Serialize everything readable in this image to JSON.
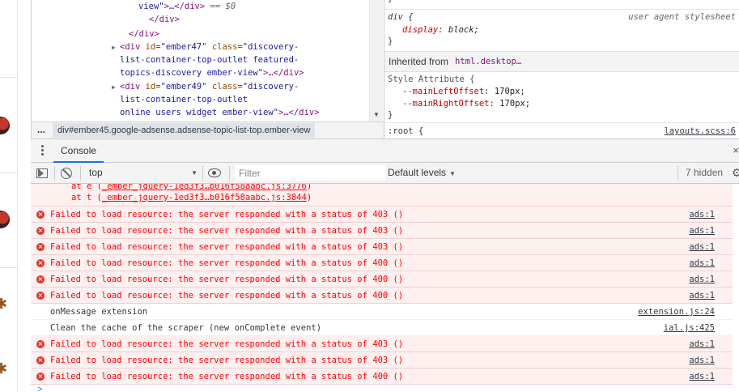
{
  "elements_panel": {
    "lines": [
      {
        "indent": 170,
        "tokens": [
          {
            "c": "val",
            "t": "view\""
          },
          {
            "c": "tag",
            "t": ">…</div>"
          },
          {
            "c": "dim",
            "t": " == $0"
          }
        ]
      },
      {
        "indent": 183,
        "tokens": [
          {
            "c": "tag",
            "t": "</div>"
          }
        ]
      },
      {
        "indent": 158,
        "tokens": [
          {
            "c": "tag",
            "t": "</div>"
          }
        ]
      },
      {
        "indent": 147,
        "arrow": true,
        "tokens": [
          {
            "c": "tag",
            "t": "<div "
          },
          {
            "c": "attr",
            "t": "id"
          },
          {
            "c": "tag",
            "t": "="
          },
          {
            "c": "val",
            "t": "\"ember47\""
          },
          {
            "c": "attr",
            "t": " class"
          },
          {
            "c": "tag",
            "t": "="
          },
          {
            "c": "val",
            "t": "\"discovery-"
          }
        ]
      },
      {
        "indent": 147,
        "tokens": [
          {
            "c": "val",
            "t": "list-container-top-outlet featured-"
          }
        ]
      },
      {
        "indent": 147,
        "tokens": [
          {
            "c": "val",
            "t": "topics-discovery ember-view\""
          },
          {
            "c": "tag",
            "t": ">…</div>"
          }
        ]
      },
      {
        "indent": 147,
        "arrow": true,
        "tokens": [
          {
            "c": "tag",
            "t": "<div "
          },
          {
            "c": "attr",
            "t": "id"
          },
          {
            "c": "tag",
            "t": "="
          },
          {
            "c": "val",
            "t": "\"ember49\""
          },
          {
            "c": "attr",
            "t": " class"
          },
          {
            "c": "tag",
            "t": "="
          },
          {
            "c": "val",
            "t": "\"discovery-"
          }
        ]
      },
      {
        "indent": 147,
        "tokens": [
          {
            "c": "val",
            "t": "list-container-top-outlet"
          }
        ]
      },
      {
        "indent": 147,
        "tokens": [
          {
            "c": "val",
            "t": "online users widget ember-view\""
          },
          {
            "c": "tag",
            "t": ">…</div>"
          }
        ]
      }
    ]
  },
  "breadcrumb": {
    "dots": "...",
    "selected": "div#ember45.google-adsense.adsense-topic-list-top.ember-view"
  },
  "styles_panel": {
    "top_brace": "}",
    "rule1_selector": "div {",
    "rule1_origin": "user agent stylesheet",
    "rule1_prop": "display",
    "rule1_value": "block;",
    "rule1_close": "}",
    "inherited_label": "Inherited from ",
    "inherited_link": "html.desktop…",
    "style_attr_header": "Style Attribute {",
    "prop1_name": "--mainLeftOffset",
    "prop1_value": "170px;",
    "prop2_name": "--mainRightOffset",
    "prop2_value": "170px;",
    "style_attr_close": "}",
    "root_selector": ":root {",
    "root_source": "layouts.scss:6"
  },
  "drawer": {
    "console_tab": "Console",
    "close": "×"
  },
  "toolbar": {
    "context": "top",
    "filter_placeholder": "Filter",
    "levels": "Default levels",
    "hidden": "7 hidden"
  },
  "console": {
    "stack": [
      {
        "prefix": "at e (",
        "link": "_ember_jquery-1ed3f3…b016f58aabc.js:3776",
        "suffix": ")"
      },
      {
        "prefix": "at t (",
        "link": "_ember_jquery-1ed3f3…b016f58aabc.js:3844",
        "suffix": ")"
      }
    ],
    "messages": [
      {
        "level": "error",
        "text": "Failed to load resource: the server responded with a status of 403 ()",
        "source": "ads:1"
      },
      {
        "level": "error",
        "text": "Failed to load resource: the server responded with a status of 403 ()",
        "source": "ads:1"
      },
      {
        "level": "error",
        "text": "Failed to load resource: the server responded with a status of 403 ()",
        "source": "ads:1"
      },
      {
        "level": "error",
        "text": "Failed to load resource: the server responded with a status of 400 ()",
        "source": "ads:1"
      },
      {
        "level": "error",
        "text": "Failed to load resource: the server responded with a status of 400 ()",
        "source": "ads:1"
      },
      {
        "level": "error",
        "text": "Failed to load resource: the server responded with a status of 400 ()",
        "source": "ads:1"
      },
      {
        "level": "log",
        "text": "onMessage extension",
        "source": "extension.js:24"
      },
      {
        "level": "log",
        "text": "Clean the cache of the scraper (new onComplete event)",
        "source": "ial.js:425"
      },
      {
        "level": "error",
        "text": "Failed to load resource: the server responded with a status of 403 ()",
        "source": "ads:1"
      },
      {
        "level": "error",
        "text": "Failed to load resource: the server responded with a status of 403 ()",
        "source": "ads:1"
      },
      {
        "level": "error",
        "text": "Failed to load resource: the server responded with a status of 400 ()",
        "source": "ads:1"
      }
    ],
    "prompt": ">"
  },
  "colors": {
    "error_bg": "#fff0f0",
    "error_text": "#ff0000",
    "accent": "#1a73e8"
  }
}
